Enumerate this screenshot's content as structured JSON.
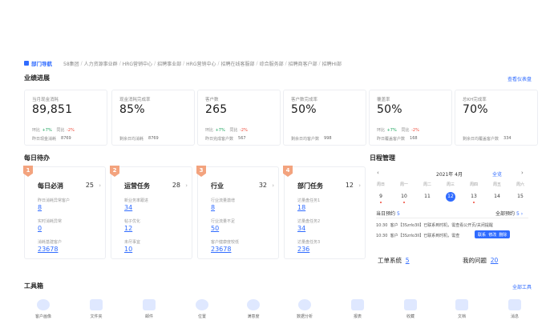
{
  "breadcrumb": {
    "home": "部门导航",
    "items": [
      "58集团",
      "人力资源事业群",
      "HRG营销中心",
      "招聘事业部",
      "HRG营销中心",
      "招聘在线客服部",
      "综合服务部",
      "招聘商客户部",
      "招聘HI部"
    ]
  },
  "performance": {
    "title": "业绩进展",
    "link": "查看仪表盘",
    "cards": [
      {
        "label": "当月现金消耗",
        "value": "89,851",
        "yoy_label": "环比",
        "yoy": "+7%",
        "mom_label": "同比",
        "mom": "-2%",
        "foot_label": "昨日现金消耗",
        "foot_value": "8769"
      },
      {
        "label": "现金消耗完成率",
        "value": "85%",
        "foot_label": "剩余日均消耗",
        "foot_value": "8769"
      },
      {
        "label": "客户数",
        "value": "265",
        "yoy_label": "环比",
        "yoy": "+7%",
        "mom_label": "同比",
        "mom": "-2%",
        "foot_label": "昨日完成客户数",
        "foot_value": "567"
      },
      {
        "label": "客户数完成率",
        "value": "50%",
        "foot_label": "剩余日均客户数",
        "foot_value": "998"
      },
      {
        "label": "覆盖率",
        "value": "50%",
        "yoy_label": "环比",
        "yoy": "+7%",
        "mom_label": "同比",
        "mom": "-2%",
        "foot_label": "昨日覆盖客户数",
        "foot_value": "168"
      },
      {
        "label": "总KH完成率",
        "value": "70%",
        "foot_label": "剩余日均覆盖客户数",
        "foot_value": "334"
      }
    ]
  },
  "daily": {
    "title": "每日待办",
    "tasks": [
      {
        "rank": "1",
        "title": "每日必消",
        "count": "25",
        "items": [
          {
            "label": "昨日消耗异常客户",
            "value": "8"
          },
          {
            "label": "实时消耗异常",
            "value": "0"
          },
          {
            "label": "消耗基建客户",
            "value": "23678"
          }
        ]
      },
      {
        "rank": "2",
        "title": "运营任务",
        "count": "28",
        "items": [
          {
            "label": "新业务率跟进",
            "value": "34"
          },
          {
            "label": "帖子优化",
            "value": "12"
          },
          {
            "label": "未尽事宜",
            "value": "10"
          }
        ]
      },
      {
        "rank": "3",
        "title": "行业",
        "count": "32",
        "items": [
          {
            "label": "行业流量激增",
            "value": "8"
          },
          {
            "label": "行业流量不足",
            "value": "50"
          },
          {
            "label": "客户健康度较低",
            "value": "23678"
          }
        ]
      },
      {
        "rank": "4",
        "title": "部门任务",
        "count": "12",
        "items": [
          {
            "label": "达量盘任务1",
            "value": "18"
          },
          {
            "label": "达量盘任务2",
            "value": "34"
          },
          {
            "label": "达量盘任务3",
            "value": "236"
          }
        ]
      }
    ]
  },
  "schedule": {
    "title": "日程管理",
    "prev": "‹",
    "next": "›",
    "month": "2021年 4月",
    "month_link": "全览",
    "weekdays": [
      "周日",
      "周一",
      "周二",
      "周三",
      "周四",
      "周五",
      "周六"
    ],
    "days": [
      "9",
      "10",
      "11",
      "12",
      "13",
      "14",
      "15"
    ],
    "today_label": "当日预约",
    "today_count": "5",
    "all_label": "全部预约",
    "all_count": "5",
    "entries": [
      {
        "time": "10:30",
        "text": "客户【3Szrlo3II】已联系到时机，需查看公开页/关闭提醒"
      },
      {
        "time": "10:30",
        "text": "客户【3Szrlo3II】已联系到时机，需查"
      }
    ],
    "actions": [
      "联系",
      "修改",
      "删除"
    ]
  },
  "tickets": {
    "label": "工单系统",
    "count": "5"
  },
  "questions": {
    "label": "我的问题",
    "count": "20"
  },
  "tools": {
    "title": "工具箱",
    "link": "全部工具",
    "items": [
      "客户画像",
      "文件夹",
      "邮件",
      "位置",
      "满意度",
      "数据分析",
      "报表",
      "收藏",
      "文档",
      "消息"
    ]
  }
}
